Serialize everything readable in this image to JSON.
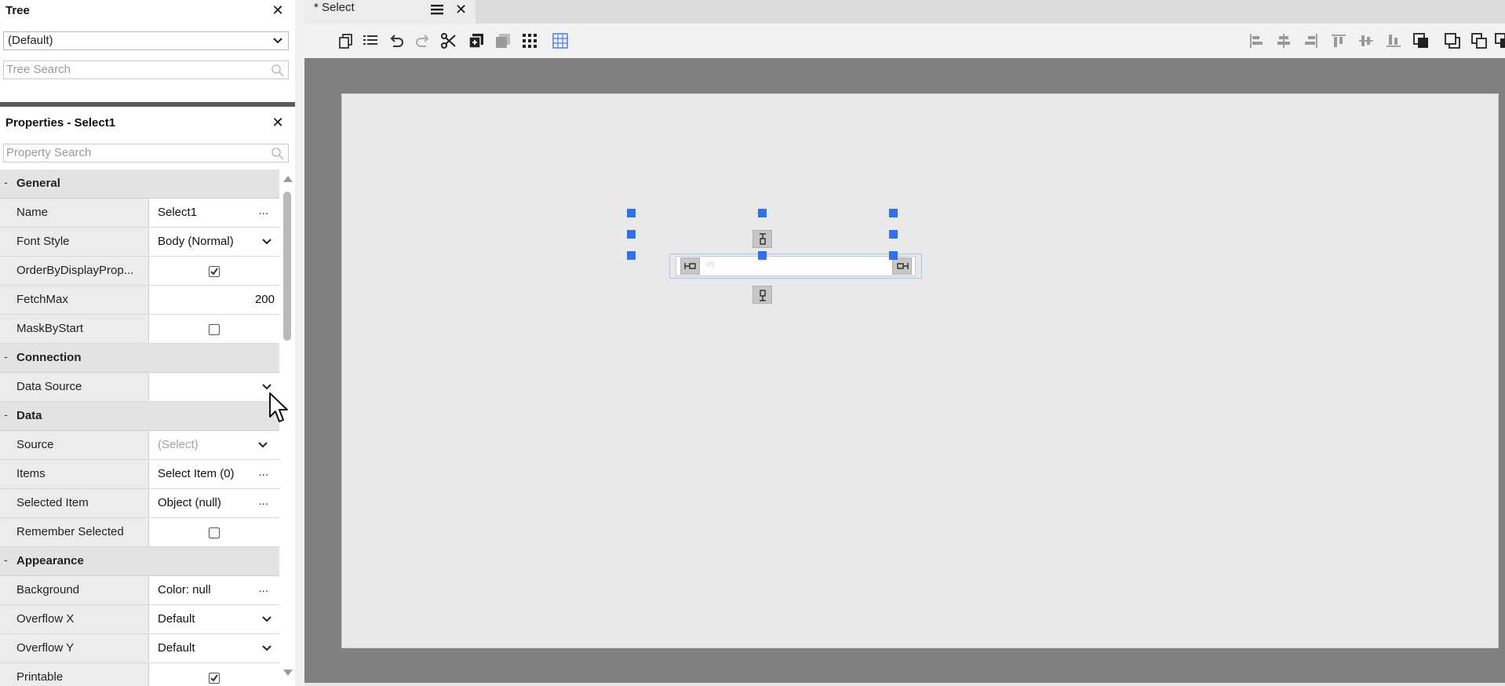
{
  "tree": {
    "title": "Tree",
    "dropdown_value": "(Default)",
    "search_placeholder": "Tree Search"
  },
  "properties": {
    "title": "Properties - Select1",
    "search_placeholder": "Property Search",
    "sections": {
      "general": "General",
      "connection": "Connection",
      "data": "Data",
      "appearance": "Appearance"
    },
    "rows": {
      "name": {
        "label": "Name",
        "value": "Select1",
        "button": "..."
      },
      "font_style": {
        "label": "Font Style",
        "value": "Body (Normal)"
      },
      "order_by": {
        "label": "OrderByDisplayProp...",
        "checked": true
      },
      "fetch_max": {
        "label": "FetchMax",
        "value": "200"
      },
      "mask_by_start": {
        "label": "MaskByStart",
        "checked": false
      },
      "data_source": {
        "label": "Data Source",
        "value": ""
      },
      "source": {
        "label": "Source",
        "value": "(Select)"
      },
      "items": {
        "label": "Items",
        "value": "Select Item (0)",
        "button": "..."
      },
      "selected_item": {
        "label": "Selected Item",
        "value": "Object (null)",
        "button": "..."
      },
      "remember_selected": {
        "label": "Remember Selected",
        "checked": false
      },
      "background": {
        "label": "Background",
        "value": "Color: null",
        "button": "..."
      },
      "overflow_x": {
        "label": "Overflow X",
        "value": "Default"
      },
      "overflow_y": {
        "label": "Overflow Y",
        "value": "Default"
      },
      "printable": {
        "label": "Printable",
        "checked": true
      }
    }
  },
  "tab": {
    "label": "* Select"
  },
  "widget": {
    "placeholder": "ct)"
  },
  "colors": {
    "accent": "#2f6ff1",
    "canvas_bg": "#808080",
    "page_bg": "#e9e9ea"
  },
  "icons": {
    "toolbar_left": [
      "copy-icon",
      "list-icon",
      "undo-icon",
      "redo-icon",
      "cut-icon",
      "paste-icon",
      "layer-icon",
      "grid-dots-icon",
      "snap-grid-icon"
    ],
    "toolbar_right": [
      "align-left-icon",
      "align-center-icon",
      "align-right-icon",
      "align-top-icon",
      "align-middle-icon",
      "align-bottom-icon",
      "bring-front-icon",
      "send-back-icon",
      "group-icon",
      "ungroup-icon"
    ]
  }
}
